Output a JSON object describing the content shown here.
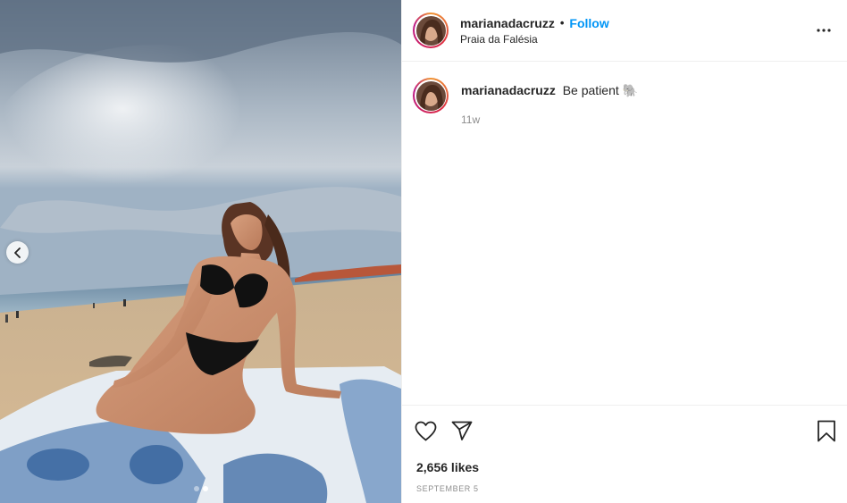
{
  "post": {
    "author": {
      "username": "marianadacruzz",
      "location": "Praia da Falésia"
    },
    "header": {
      "separator": "•",
      "follow_label": "Follow",
      "more_icon": "more-horizontal-icon"
    },
    "caption": {
      "username": "marianadacruzz",
      "text": "Be patient 🐘",
      "age": "11w"
    },
    "likes_text": "2,656 likes",
    "date_text": "September 5",
    "carousel": {
      "slide_count": 2,
      "active_index": 1
    },
    "icons": {
      "like": "heart-icon",
      "share": "paper-plane-icon",
      "save": "bookmark-icon",
      "prev": "chevron-left-icon"
    },
    "colors": {
      "follow_blue": "#0095f6",
      "text": "#262626",
      "muted": "#8e8e8e",
      "divider": "#efefef"
    }
  }
}
